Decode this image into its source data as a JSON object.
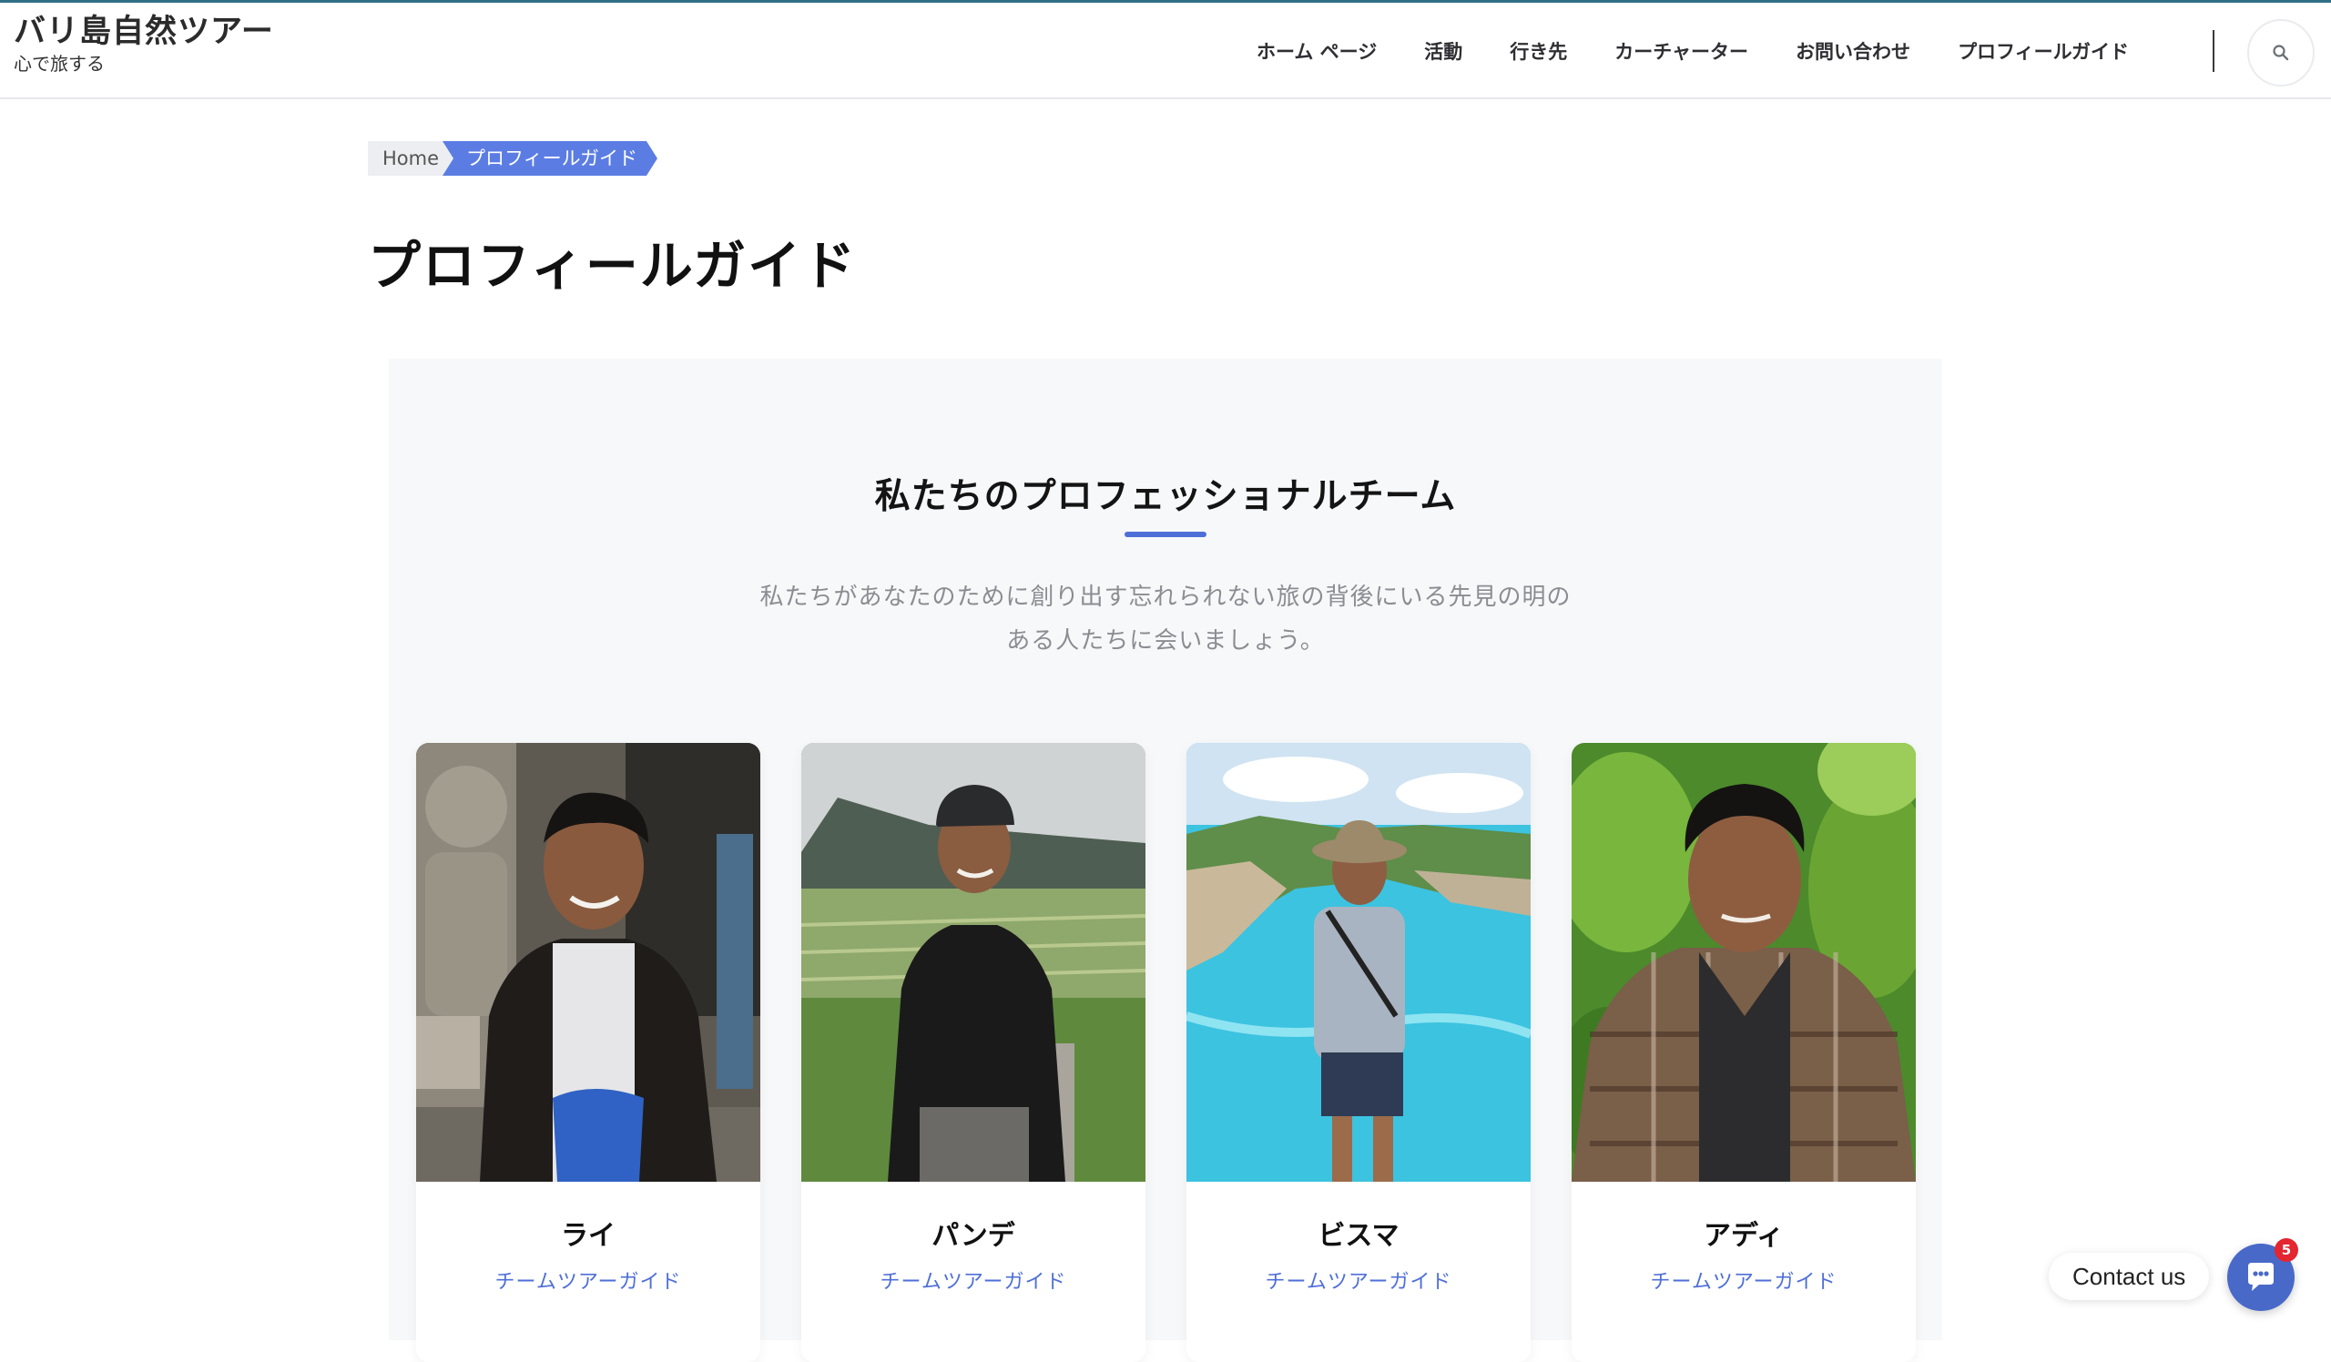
{
  "header": {
    "site_title": "バリ島自然ツアー",
    "site_tagline": "心で旅する",
    "nav": [
      "ホーム ページ",
      "活動",
      "行き先",
      "カーチャーター",
      "お問い合わせ",
      "プロフィールガイド"
    ],
    "search_icon": "search-icon"
  },
  "breadcrumb": {
    "home": "Home",
    "current": "プロフィールガイド"
  },
  "page_title": "プロフィールガイド",
  "team": {
    "heading": "私たちのプロフェッショナルチーム",
    "desc_line1": "私たちがあなたのために創り出す忘れられない旅の背後にいる先見の明の",
    "desc_line2": "ある人たちに会いましょう。",
    "members": [
      {
        "name": "ライ",
        "role": "チームツアーガイド"
      },
      {
        "name": "パンデ",
        "role": "チームツアーガイド"
      },
      {
        "name": "ビスマ",
        "role": "チームツアーガイド"
      },
      {
        "name": "アディ",
        "role": "チームツアーガイド"
      }
    ]
  },
  "contact": {
    "label": "Contact us",
    "badge": "5"
  },
  "colors": {
    "accent": "#5b7de3",
    "role_text": "#4f6fd8",
    "chat": "#4869c8",
    "badge": "#e3262f"
  }
}
